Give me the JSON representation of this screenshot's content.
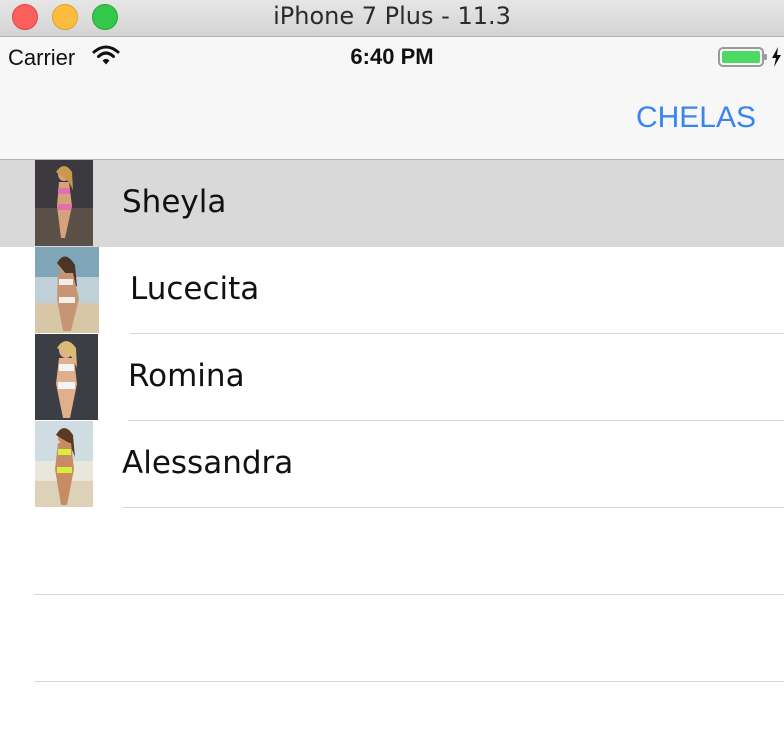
{
  "window": {
    "title": "iPhone 7 Plus - 11.3"
  },
  "status_bar": {
    "carrier": "Carrier",
    "time": "6:40 PM"
  },
  "nav": {
    "right_button": "CHELAS"
  },
  "list": {
    "items": [
      {
        "label": "Sheyla",
        "selected": true
      },
      {
        "label": "Lucecita"
      },
      {
        "label": "Romina"
      },
      {
        "label": "Alessandra"
      }
    ]
  },
  "colors": {
    "accent": "#3a84ee",
    "selected_row": "#d9d9d9",
    "battery": "#4cd964"
  }
}
